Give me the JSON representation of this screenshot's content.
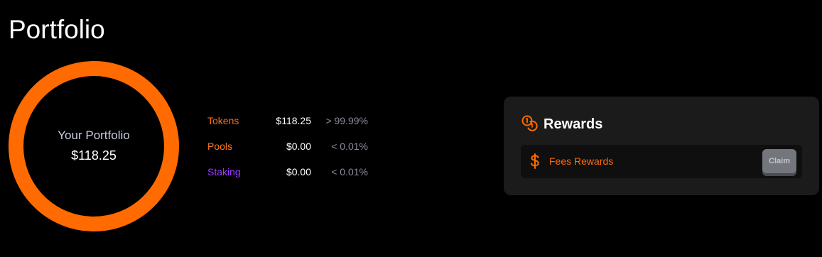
{
  "page": {
    "title": "Portfolio"
  },
  "portfolio": {
    "label": "Your Portfolio",
    "total": "$118.25",
    "ring_color": "#ff6b00"
  },
  "breakdown": [
    {
      "name": "Tokens",
      "value": "$118.25",
      "percent": "> 99.99%",
      "color": "#ff6b0f"
    },
    {
      "name": "Pools",
      "value": "$0.00",
      "percent": "< 0.01%",
      "color": "#ff7a1a"
    },
    {
      "name": "Staking",
      "value": "$0.00",
      "percent": "< 0.01%",
      "color": "#9b3dff"
    }
  ],
  "rewards": {
    "title": "Rewards",
    "icon": "coins-icon",
    "items": [
      {
        "icon": "dollar-icon",
        "label": "Fees Rewards",
        "button_label": "Claim"
      }
    ]
  },
  "colors": {
    "accent": "#ff6b00",
    "card_bg": "#1b1b1b",
    "row_bg": "#0f0f0f",
    "claim_disabled": "#73767d"
  }
}
